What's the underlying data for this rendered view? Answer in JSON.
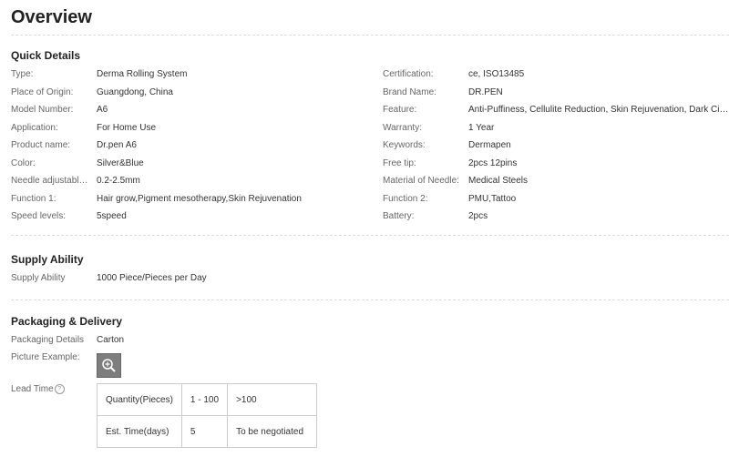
{
  "overview_title": "Overview",
  "quick_details": {
    "heading": "Quick Details",
    "left": [
      {
        "label": "Type:",
        "value": "Derma Rolling System"
      },
      {
        "label": "Place of Origin:",
        "value": "Guangdong, China"
      },
      {
        "label": "Model Number:",
        "value": "A6"
      },
      {
        "label": "Application:",
        "value": "For Home Use"
      },
      {
        "label": "Product name:",
        "value": "Dr.pen A6"
      },
      {
        "label": "Color:",
        "value": "Silver&Blue"
      },
      {
        "label": "Needle adjustable l...",
        "value": "0.2-2.5mm"
      },
      {
        "label": "Function 1:",
        "value": "Hair grow,Pigment mesotherapy,Skin Rejuvenation"
      },
      {
        "label": "Speed levels:",
        "value": "5speed"
      }
    ],
    "right": [
      {
        "label": "Certification:",
        "value": "ce, ISO13485"
      },
      {
        "label": "Brand Name:",
        "value": "DR.PEN"
      },
      {
        "label": "Feature:",
        "value": "Anti-Puffiness, Cellulite Reduction, Skin Rejuvenation, Dark Cir..."
      },
      {
        "label": "Warranty:",
        "value": "1 Year"
      },
      {
        "label": "Keywords:",
        "value": "Dermapen"
      },
      {
        "label": "Free tip:",
        "value": "2pcs 12pins"
      },
      {
        "label": "Material of Needle:",
        "value": "Medical Steels"
      },
      {
        "label": "Function 2:",
        "value": "PMU,Tattoo"
      },
      {
        "label": "Battery:",
        "value": "2pcs"
      }
    ]
  },
  "supply": {
    "heading": "Supply Ability",
    "label": "Supply Ability",
    "value": "1000 Piece/Pieces per Day"
  },
  "packaging": {
    "heading": "Packaging & Delivery",
    "details_label": "Packaging Details",
    "details_value": "Carton",
    "picture_label": "Picture Example:",
    "zoom_icon": "zoom-in-icon",
    "lead_time_label": "Lead Time",
    "help_icon": "question-icon",
    "help_glyph": "?",
    "lead_table": [
      [
        "Quantity(Pieces)",
        "1 - 100",
        ">100"
      ],
      [
        "Est. Time(days)",
        "5",
        "To be negotiated"
      ]
    ]
  }
}
